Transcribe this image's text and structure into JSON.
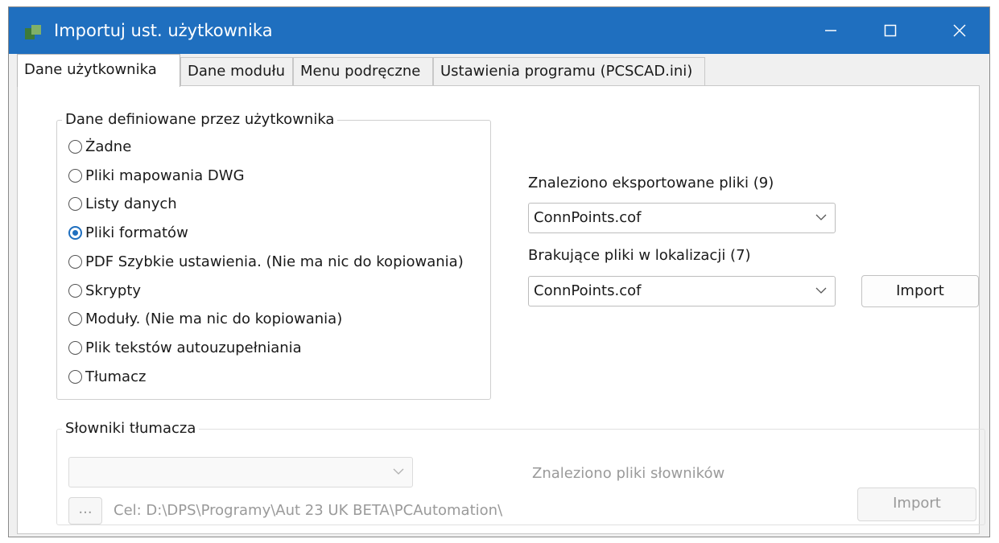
{
  "window": {
    "title": "Importuj ust. użytkownika"
  },
  "tabs": [
    {
      "label": "Dane użytkownika"
    },
    {
      "label": "Dane modułu"
    },
    {
      "label": "Menu podręczne"
    },
    {
      "label": "Ustawienia programu (PCSCAD.ini)"
    }
  ],
  "user_data_group": {
    "legend": "Dane definiowane przez użytkownika",
    "options": [
      {
        "label": "Żadne",
        "selected": false
      },
      {
        "label": "Pliki mapowania DWG",
        "selected": false
      },
      {
        "label": "Listy danych",
        "selected": false
      },
      {
        "label": "Pliki formatów",
        "selected": true
      },
      {
        "label": "PDF Szybkie ustawienia. (Nie ma nic do kopiowania)",
        "selected": false
      },
      {
        "label": "Skrypty",
        "selected": false
      },
      {
        "label": "Moduły. (Nie ma nic do kopiowania)",
        "selected": false
      },
      {
        "label": "Plik tekstów autouzupełniania",
        "selected": false
      },
      {
        "label": "Tłumacz",
        "selected": false
      }
    ]
  },
  "exported": {
    "label": "Znaleziono eksportowane pliki (9)",
    "value": "ConnPoints.cof"
  },
  "missing": {
    "label": "Brakujące pliki w lokalizacji (7)",
    "value": "ConnPoints.cof"
  },
  "import_label": "Import",
  "dictionaries": {
    "legend": "Słowniki tłumacza",
    "select_value": "",
    "found_label": "Znaleziono pliki słowników",
    "browse_label": "...",
    "target_label": "Cel: D:\\DPS\\Programy\\Aut 23 UK BETA\\PCAutomation\\",
    "import_label": "Import"
  },
  "colors": {
    "titlebar": "#1f6fbf",
    "accent": "#1f6fbf"
  },
  "icons": [
    "app-icon",
    "minimize-icon",
    "maximize-icon",
    "close-icon",
    "chevron-down-icon"
  ]
}
